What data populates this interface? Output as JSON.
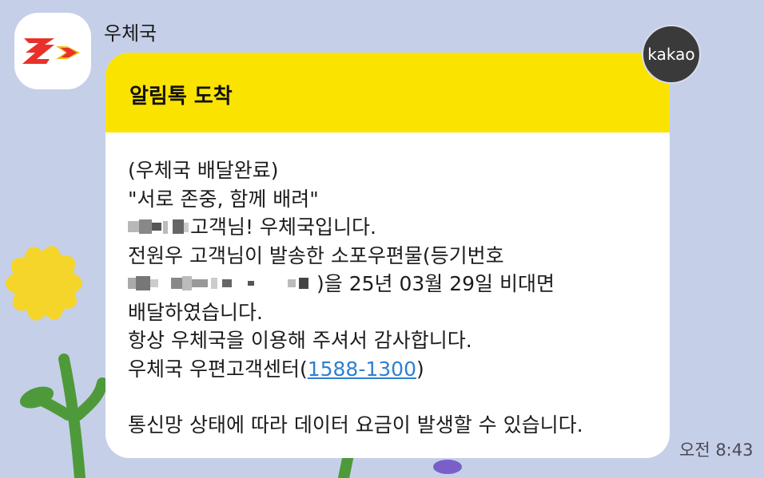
{
  "chat": {
    "sender_name": "우체국",
    "badge_label": "kakao",
    "time": "오전 8:43",
    "avatar_icon": "korea-post-logo-icon"
  },
  "message": {
    "header_title": "알림톡 도착",
    "lines": {
      "l1": "(우체국 배달완료)",
      "l2": "\"서로 존중, 함께 배려\"",
      "l3_suffix": "고객님! 우체국입니다.",
      "l4": "전원우 고객님이 발송한 소포우편물(등기번호",
      "l5_suffix": ")을 25년 03월 29일 비대면",
      "l6": "배달하였습니다.",
      "l7": "항상 우체국을 이용해 주셔서 감사합니다.",
      "l8_prefix": "우체국 우편고객센터(",
      "l8_phone": "1588-1300",
      "l8_suffix": ")",
      "l10": "통신망 상태에 따라 데이터 요금이 발생할 수 있습니다."
    }
  },
  "colors": {
    "background": "#c6cfe8",
    "header_yellow": "#fbe300",
    "link_blue": "#2f7fd0",
    "post_red": "#e8312a",
    "post_gold": "#f3b81a"
  }
}
